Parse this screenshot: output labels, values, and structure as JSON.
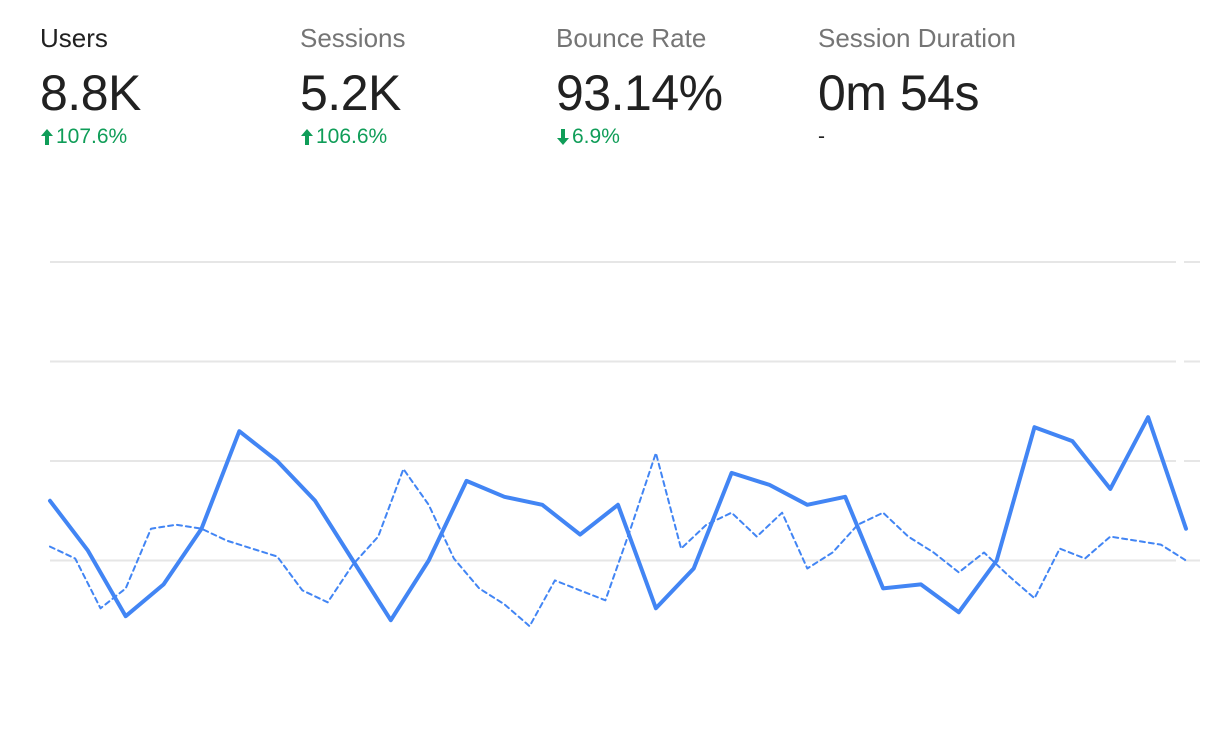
{
  "metrics": [
    {
      "title": "Users",
      "value": "8.8K",
      "change": "107.6%",
      "direction": "up",
      "active": true
    },
    {
      "title": "Sessions",
      "value": "5.2K",
      "change": "106.6%",
      "direction": "up",
      "active": false
    },
    {
      "title": "Bounce Rate",
      "value": "93.14%",
      "change": "6.9%",
      "direction": "down",
      "active": false
    },
    {
      "title": "Session Duration",
      "value": "0m 54s",
      "change": "-",
      "direction": "none",
      "active": false
    }
  ],
  "colors": {
    "positive": "#0f9d58",
    "text_primary": "#212121",
    "text_secondary": "#757575",
    "series_current": "#4285f4",
    "series_previous": "#4285f4",
    "grid": "#e6e6e6"
  },
  "chart_data": {
    "type": "line",
    "title": "",
    "xlabel": "",
    "ylabel": "",
    "ylim": [
      0,
      100
    ],
    "grid": true,
    "gridlines": [
      0,
      25,
      50,
      75,
      100
    ],
    "legend": "none",
    "x": [
      1,
      2,
      3,
      4,
      5,
      6,
      7,
      8,
      9,
      10,
      11,
      12,
      13,
      14,
      15,
      16,
      17,
      18,
      19,
      20,
      21,
      22,
      23,
      24,
      25,
      26,
      27,
      28,
      29
    ],
    "series": [
      {
        "style": "solid",
        "values": [
          40,
          27.5,
          11,
          19,
          33,
          57.5,
          50,
          40,
          25,
          10,
          25,
          45,
          41,
          39,
          31.5,
          39,
          13,
          23,
          47,
          44,
          39,
          41,
          18,
          19,
          12,
          25,
          58.5,
          55,
          43,
          61,
          33
        ]
      },
      {
        "style": "dashed",
        "values": [
          28.5,
          25.5,
          13,
          18,
          33,
          34,
          33,
          30,
          28,
          26,
          17.5,
          14.5,
          24,
          31,
          48,
          39,
          25.5,
          18,
          14,
          8.5,
          20,
          17.5,
          15,
          33,
          52,
          28,
          34,
          37,
          31,
          37,
          23,
          27,
          34,
          37,
          31,
          27,
          22,
          27,
          21,
          15.5,
          28,
          25.5,
          31,
          30,
          29,
          25
        ]
      }
    ]
  }
}
